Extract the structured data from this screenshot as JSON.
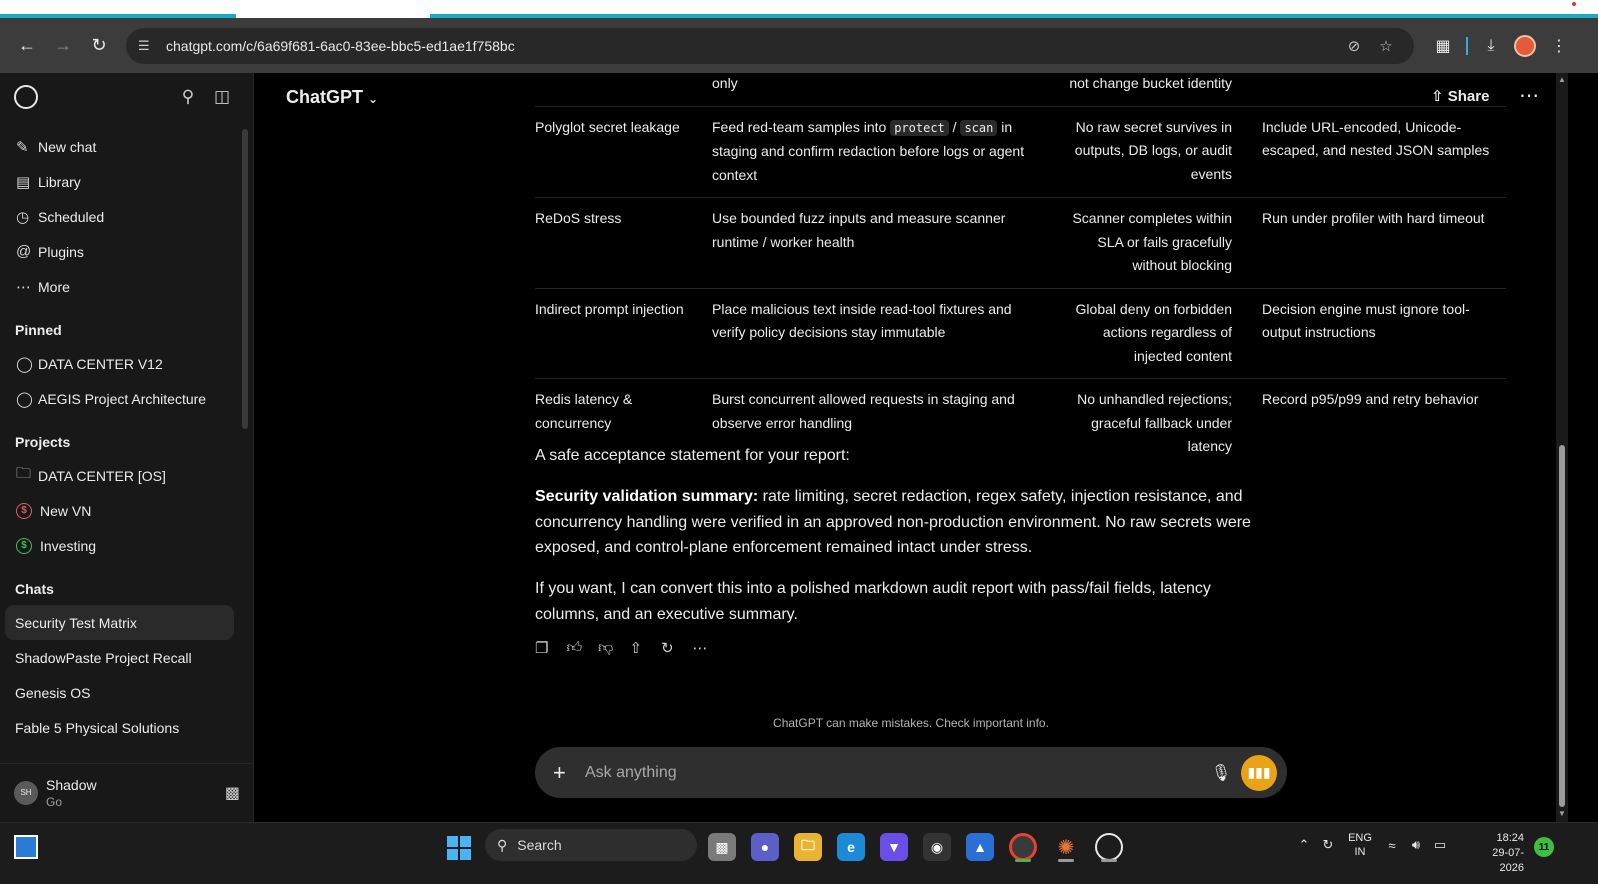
{
  "browser": {
    "url": "chatgpt.com/c/6a69f681-6ac0-83ee-bbc5-ed1ae1f758bc",
    "icons": {
      "back": "arrow-left-icon",
      "forward": "arrow-right-icon",
      "reload": "reload-icon",
      "site_info": "tune-icon",
      "eye_off": "eye-off-icon",
      "bookmark": "star-icon",
      "extensions": "puzzle-icon",
      "downloads": "download-icon",
      "menu": "kebab-icon"
    }
  },
  "sidebar": {
    "nav": [
      {
        "label": "New chat",
        "icon": "edit-icon"
      },
      {
        "label": "Library",
        "icon": "library-icon"
      },
      {
        "label": "Scheduled",
        "icon": "clock-icon"
      },
      {
        "label": "Plugins",
        "icon": "at-icon"
      },
      {
        "label": "More",
        "icon": "dots-icon"
      }
    ],
    "pinned_header": "Pinned",
    "pinned": [
      {
        "label": "DATA CENTER V12"
      },
      {
        "label": "AEGIS Project Architecture"
      }
    ],
    "projects_header": "Projects",
    "projects": [
      {
        "label": "DATA CENTER [OS]"
      },
      {
        "label": "New VN"
      },
      {
        "label": "Investing"
      }
    ],
    "chats_header": "Chats",
    "chats": [
      {
        "label": "Security Test Matrix"
      },
      {
        "label": "ShadowPaste Project Recall"
      },
      {
        "label": "Genesis OS"
      },
      {
        "label": "Fable 5 Physical Solutions"
      }
    ],
    "user": {
      "initials": "SH",
      "name": "Shadow",
      "plan": "Go"
    }
  },
  "header": {
    "model": "ChatGPT",
    "share_label": "Share"
  },
  "table": {
    "rows": [
      {
        "c1": "",
        "c2": "only",
        "c3": "not change bucket identity",
        "c4": ""
      },
      {
        "c1": "Polyglot secret leakage",
        "c2_pre": "Feed red-team samples into",
        "c2_code1": "protect",
        "c2_sep": "/",
        "c2_code2": "scan",
        "c2_post": "in staging and confirm redaction before logs or agent context",
        "c3": "No raw secret survives in outputs, DB logs, or audit events",
        "c4": "Include URL-encoded, Unicode-escaped, and nested JSON samples"
      },
      {
        "c1": "ReDoS stress",
        "c2": "Use bounded fuzz inputs and measure scanner runtime / worker health",
        "c3": "Scanner completes within SLA or fails gracefully without blocking",
        "c4": "Run under profiler with hard timeout"
      },
      {
        "c1": "Indirect prompt injection",
        "c2": "Place malicious text inside read-tool fixtures and verify policy decisions stay immutable",
        "c3": "Global deny on forbidden actions regardless of injected content",
        "c4": "Decision engine must ignore tool-output instructions"
      },
      {
        "c1": "Redis latency & concurrency",
        "c2": "Burst concurrent allowed requests in staging and observe error handling",
        "c3": "No unhandled rejections; graceful fallback under latency",
        "c4": "Record p95/p99 and retry behavior"
      }
    ]
  },
  "message": {
    "intro": "A safe acceptance statement for your report:",
    "summary_label": "Security validation summary:",
    "summary_text": " rate limiting, secret redaction, regex safety, injection resistance, and concurrency handling were verified in an approved non-production environment. No raw secrets were exposed, and control-plane enforcement remained intact under stress.",
    "offer": "If you want, I can convert this into a polished markdown audit report with pass/fail fields, latency columns, and an executive summary."
  },
  "actions": [
    "copy-icon",
    "thumbs-up-icon",
    "thumbs-down-icon",
    "share-icon",
    "regenerate-icon",
    "more-icon"
  ],
  "disclaimer": "ChatGPT can make mistakes. Check important info.",
  "composer": {
    "placeholder": "Ask anything"
  },
  "taskbar": {
    "search_label": "Search",
    "lang_top": "ENG",
    "lang_bottom": "IN",
    "time": "18:24",
    "date": "29-07-2026",
    "notifications": "11"
  },
  "colors": {
    "sidebar_bg": "#181818",
    "main_bg": "#000000",
    "composer_bg": "#2f2f2f",
    "voice_button": "#e8a317",
    "browser_bar": "#3c3c3c"
  }
}
